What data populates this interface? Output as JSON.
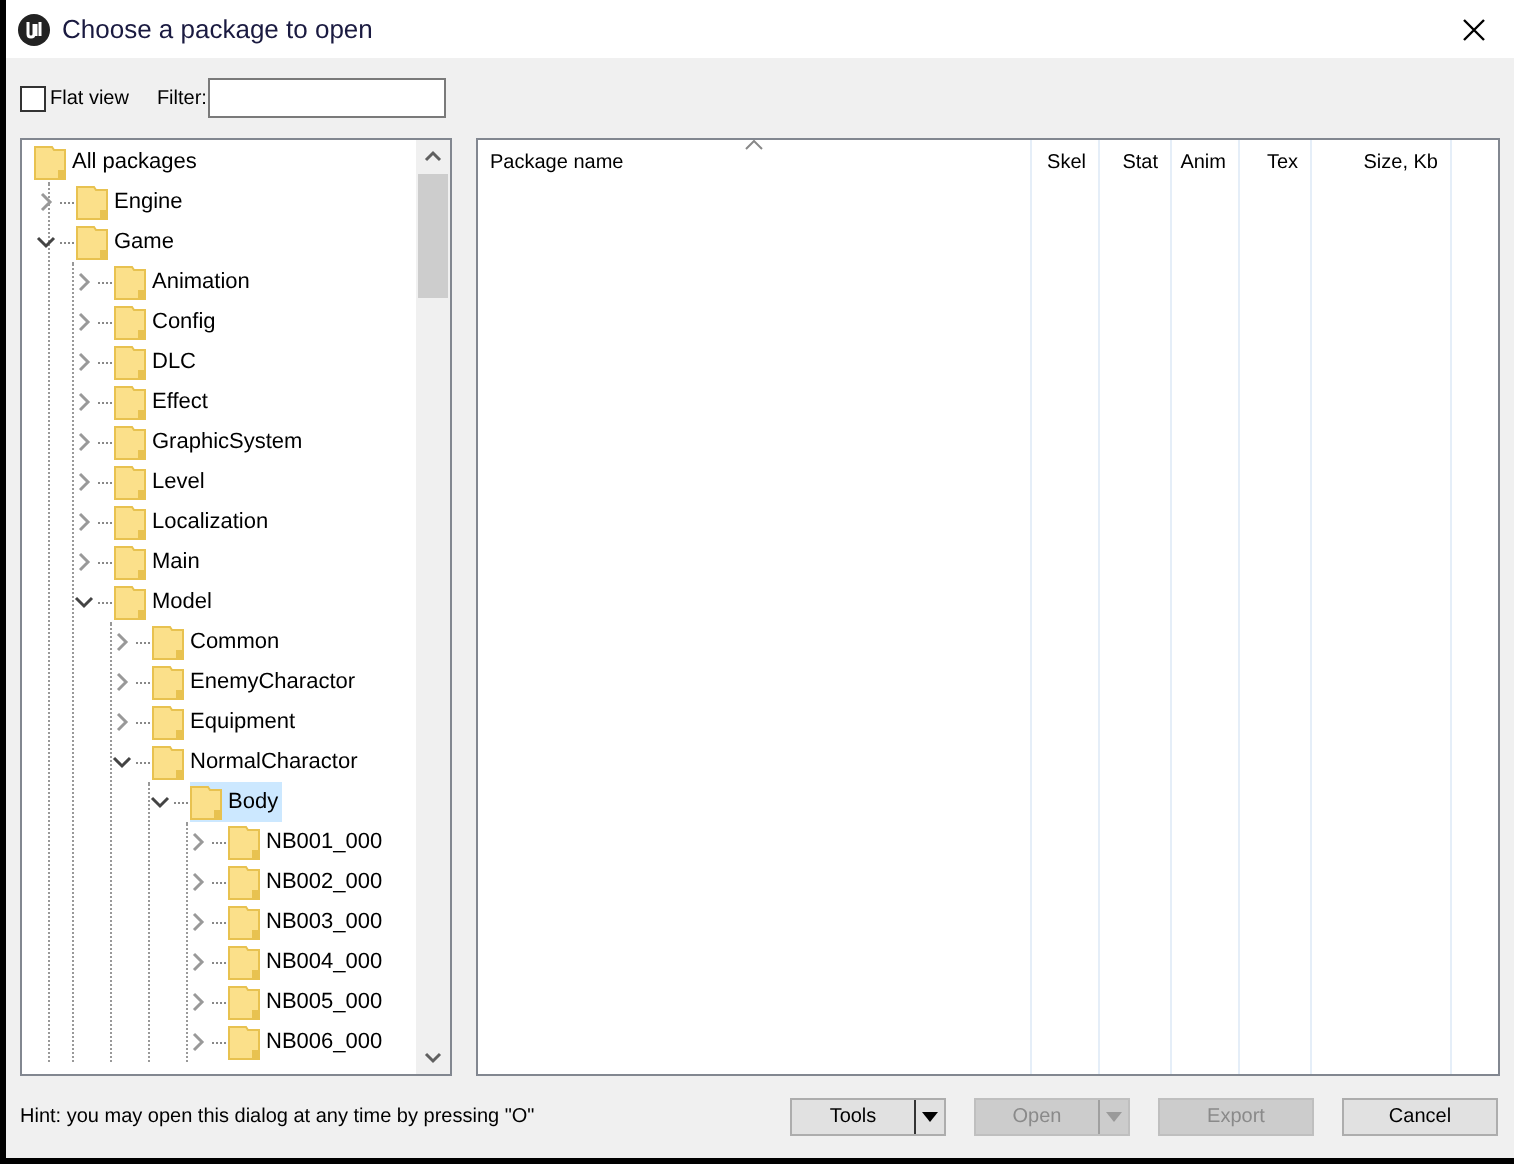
{
  "window": {
    "title": "Choose a package to open"
  },
  "flat_view": {
    "label": "Flat view",
    "checked": false
  },
  "filter": {
    "label": "Filter:"
  },
  "tree": [
    {
      "label": "All packages",
      "selected": false,
      "children": [
        {
          "label": "Engine",
          "expanded": false,
          "selected": false
        },
        {
          "label": "Game",
          "expanded": true,
          "selected": false,
          "children": [
            {
              "label": "Animation",
              "expanded": false,
              "selected": false
            },
            {
              "label": "Config",
              "expanded": false,
              "selected": false
            },
            {
              "label": "DLC",
              "expanded": false,
              "selected": false
            },
            {
              "label": "Effect",
              "expanded": false,
              "selected": false
            },
            {
              "label": "GraphicSystem",
              "expanded": false,
              "selected": false
            },
            {
              "label": "Level",
              "expanded": false,
              "selected": false
            },
            {
              "label": "Localization",
              "expanded": false,
              "selected": false
            },
            {
              "label": "Main",
              "expanded": false,
              "selected": false
            },
            {
              "label": "Model",
              "expanded": true,
              "selected": false,
              "children": [
                {
                  "label": "Common",
                  "expanded": false,
                  "selected": false
                },
                {
                  "label": "EnemyCharactor",
                  "expanded": false,
                  "selected": false
                },
                {
                  "label": "Equipment",
                  "expanded": false,
                  "selected": false
                },
                {
                  "label": "NormalCharactor",
                  "expanded": true,
                  "selected": false,
                  "children": [
                    {
                      "label": "Body",
                      "expanded": true,
                      "selected": true,
                      "children": [
                        {
                          "label": "NB001_000",
                          "expanded": false,
                          "selected": false
                        },
                        {
                          "label": "NB002_000",
                          "expanded": false,
                          "selected": false
                        },
                        {
                          "label": "NB003_000",
                          "expanded": false,
                          "selected": false
                        },
                        {
                          "label": "NB004_000",
                          "expanded": false,
                          "selected": false
                        },
                        {
                          "label": "NB005_000",
                          "expanded": false,
                          "selected": false
                        },
                        {
                          "label": "NB006_000",
                          "expanded": false,
                          "selected": false
                        }
                      ]
                    }
                  ]
                }
              ]
            }
          ]
        }
      ]
    }
  ],
  "table": {
    "columns": [
      {
        "label": "Package name",
        "sorted": true
      },
      {
        "label": "Skel",
        "sorted": false
      },
      {
        "label": "Stat",
        "sorted": false
      },
      {
        "label": "Anim",
        "sorted": false
      },
      {
        "label": "Tex",
        "sorted": false
      },
      {
        "label": "Size, Kb",
        "sorted": false
      }
    ]
  },
  "hint": "Hint: you may open this dialog at any time by pressing \"O\"",
  "buttons": [
    {
      "label": "Tools",
      "kind": "split",
      "disabled": false
    },
    {
      "label": "Open",
      "kind": "split",
      "disabled": true
    },
    {
      "label": "Export",
      "kind": "plain",
      "disabled": true
    },
    {
      "label": "Cancel",
      "kind": "plain",
      "disabled": false
    }
  ]
}
